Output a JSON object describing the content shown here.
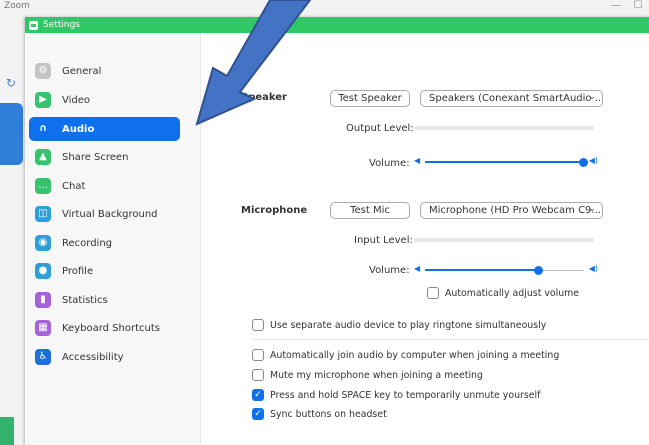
{
  "background_app": {
    "title": "Zoom",
    "min_glyph": "—",
    "max_glyph": "☐"
  },
  "window": {
    "title": "Settings"
  },
  "sidebar": {
    "items": [
      {
        "label": "General",
        "icon": "gear-icon",
        "color": "#c4c4c4",
        "glyph": "⚙"
      },
      {
        "label": "Video",
        "icon": "video-camera-icon",
        "color": "#35c36e",
        "glyph": "▶"
      },
      {
        "label": "Audio",
        "icon": "headphones-icon",
        "color": "#0e71eb",
        "glyph": "∩",
        "active": true
      },
      {
        "label": "Share Screen",
        "icon": "share-screen-icon",
        "color": "#35c36e",
        "glyph": "▲"
      },
      {
        "label": "Chat",
        "icon": "chat-bubble-icon",
        "color": "#35c36e",
        "glyph": "…"
      },
      {
        "label": "Virtual Background",
        "icon": "virtual-background-icon",
        "color": "#2f9fd9",
        "glyph": "◫"
      },
      {
        "label": "Recording",
        "icon": "recording-icon",
        "color": "#2f9fd9",
        "glyph": "◉"
      },
      {
        "label": "Profile",
        "icon": "profile-icon",
        "color": "#2f9fd9",
        "glyph": "●"
      },
      {
        "label": "Statistics",
        "icon": "statistics-icon",
        "color": "#a464d8",
        "glyph": "▮"
      },
      {
        "label": "Keyboard Shortcuts",
        "icon": "keyboard-icon",
        "color": "#a464d8",
        "glyph": "▦"
      },
      {
        "label": "Accessibility",
        "icon": "accessibility-icon",
        "color": "#1f6fd9",
        "glyph": "♿"
      }
    ]
  },
  "audio": {
    "speaker": {
      "label": "Speaker",
      "test_button": "Test Speaker",
      "device": "Speakers (Conexant SmartAudio ...",
      "output_level_label": "Output Level:",
      "volume_label": "Volume:",
      "volume_fraction": 1.0
    },
    "microphone": {
      "label": "Microphone",
      "test_button": "Test Mic",
      "device": "Microphone (HD Pro Webcam C9...",
      "input_level_label": "Input Level:",
      "volume_label": "Volume:",
      "volume_fraction": 0.72,
      "auto_adjust_label": "Automatically adjust volume",
      "auto_adjust_checked": false
    },
    "options": [
      {
        "label": "Use separate audio device to play ringtone simultaneously",
        "checked": false
      },
      {
        "label": "Automatically join audio by computer when joining a meeting",
        "checked": false
      },
      {
        "label": "Mute my microphone when joining a meeting",
        "checked": false
      },
      {
        "label": "Press and hold SPACE key to temporarily unmute yourself",
        "checked": true
      },
      {
        "label": "Sync buttons on headset",
        "checked": true
      }
    ]
  },
  "annotation": {
    "arrow_color": "#4472c4"
  }
}
